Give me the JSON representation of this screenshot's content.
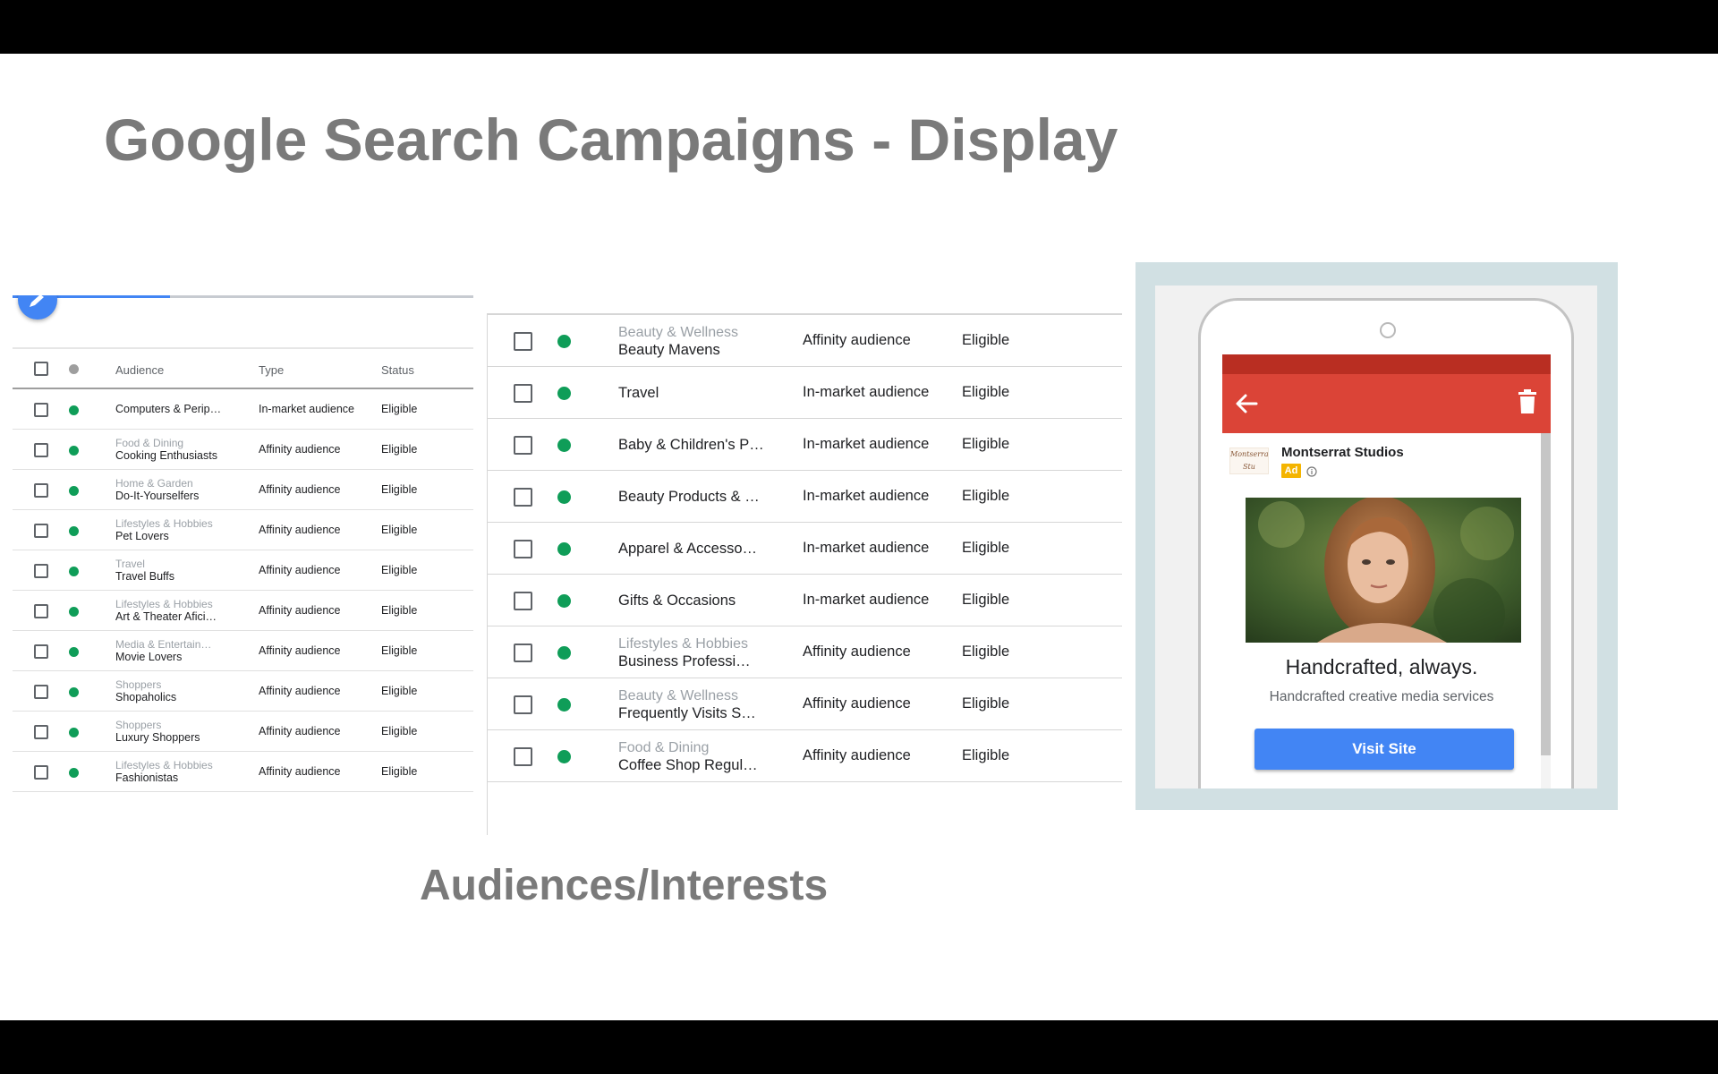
{
  "slide": {
    "title": "Google Search Campaigns - Display",
    "subtitle": "Audiences/Interests"
  },
  "left_table": {
    "columns": {
      "audience": "Audience",
      "type": "Type",
      "status": "Status"
    },
    "rows": [
      {
        "category": "",
        "name": "Computers & Perip…",
        "type": "In-market audience",
        "status": "Eligible"
      },
      {
        "category": "Food & Dining",
        "name": "Cooking Enthusiasts",
        "type": "Affinity audience",
        "status": "Eligible"
      },
      {
        "category": "Home & Garden",
        "name": "Do-It-Yourselfers",
        "type": "Affinity audience",
        "status": "Eligible"
      },
      {
        "category": "Lifestyles & Hobbies",
        "name": "Pet Lovers",
        "type": "Affinity audience",
        "status": "Eligible"
      },
      {
        "category": "Travel",
        "name": "Travel Buffs",
        "type": "Affinity audience",
        "status": "Eligible"
      },
      {
        "category": "Lifestyles & Hobbies",
        "name": "Art & Theater Afici…",
        "type": "Affinity audience",
        "status": "Eligible"
      },
      {
        "category": "Media & Entertain…",
        "name": "Movie Lovers",
        "type": "Affinity audience",
        "status": "Eligible"
      },
      {
        "category": "Shoppers",
        "name": "Shopaholics",
        "type": "Affinity audience",
        "status": "Eligible"
      },
      {
        "category": "Shoppers",
        "name": "Luxury Shoppers",
        "type": "Affinity audience",
        "status": "Eligible"
      },
      {
        "category": "Lifestyles & Hobbies",
        "name": "Fashionistas",
        "type": "Affinity audience",
        "status": "Eligible"
      }
    ]
  },
  "mid_table": {
    "rows": [
      {
        "category": "Beauty & Wellness",
        "name": "Beauty Mavens",
        "type": "Affinity audience",
        "status": "Eligible"
      },
      {
        "category": "",
        "name": "Travel",
        "type": "In-market audience",
        "status": "Eligible"
      },
      {
        "category": "",
        "name": "Baby & Children's P…",
        "type": "In-market audience",
        "status": "Eligible"
      },
      {
        "category": "",
        "name": "Beauty Products & …",
        "type": "In-market audience",
        "status": "Eligible"
      },
      {
        "category": "",
        "name": "Apparel & Accesso…",
        "type": "In-market audience",
        "status": "Eligible"
      },
      {
        "category": "",
        "name": "Gifts & Occasions",
        "type": "In-market audience",
        "status": "Eligible"
      },
      {
        "category": "Lifestyles & Hobbies",
        "name": "Business Professi…",
        "type": "Affinity audience",
        "status": "Eligible"
      },
      {
        "category": "Beauty & Wellness",
        "name": "Frequently Visits S…",
        "type": "Affinity audience",
        "status": "Eligible"
      },
      {
        "category": "Food & Dining",
        "name": "Coffee Shop Regul…",
        "type": "Affinity audience",
        "status": "Eligible"
      }
    ]
  },
  "ad_preview": {
    "advertiser": "Montserrat Studios",
    "badge": "Ad",
    "logo_text": "Montserrat Stu",
    "headline": "Handcrafted, always.",
    "description": "Handcrafted creative media services",
    "cta_label": "Visit Site"
  },
  "icons": {
    "fab": "edit-icon",
    "back": "arrow-back-icon",
    "delete": "trash-icon",
    "info": "info-icon"
  },
  "colors": {
    "accent_blue": "#4285f4",
    "status_green": "#0f9d58",
    "appbar_red": "#db4437",
    "ad_badge": "#f4b400"
  }
}
